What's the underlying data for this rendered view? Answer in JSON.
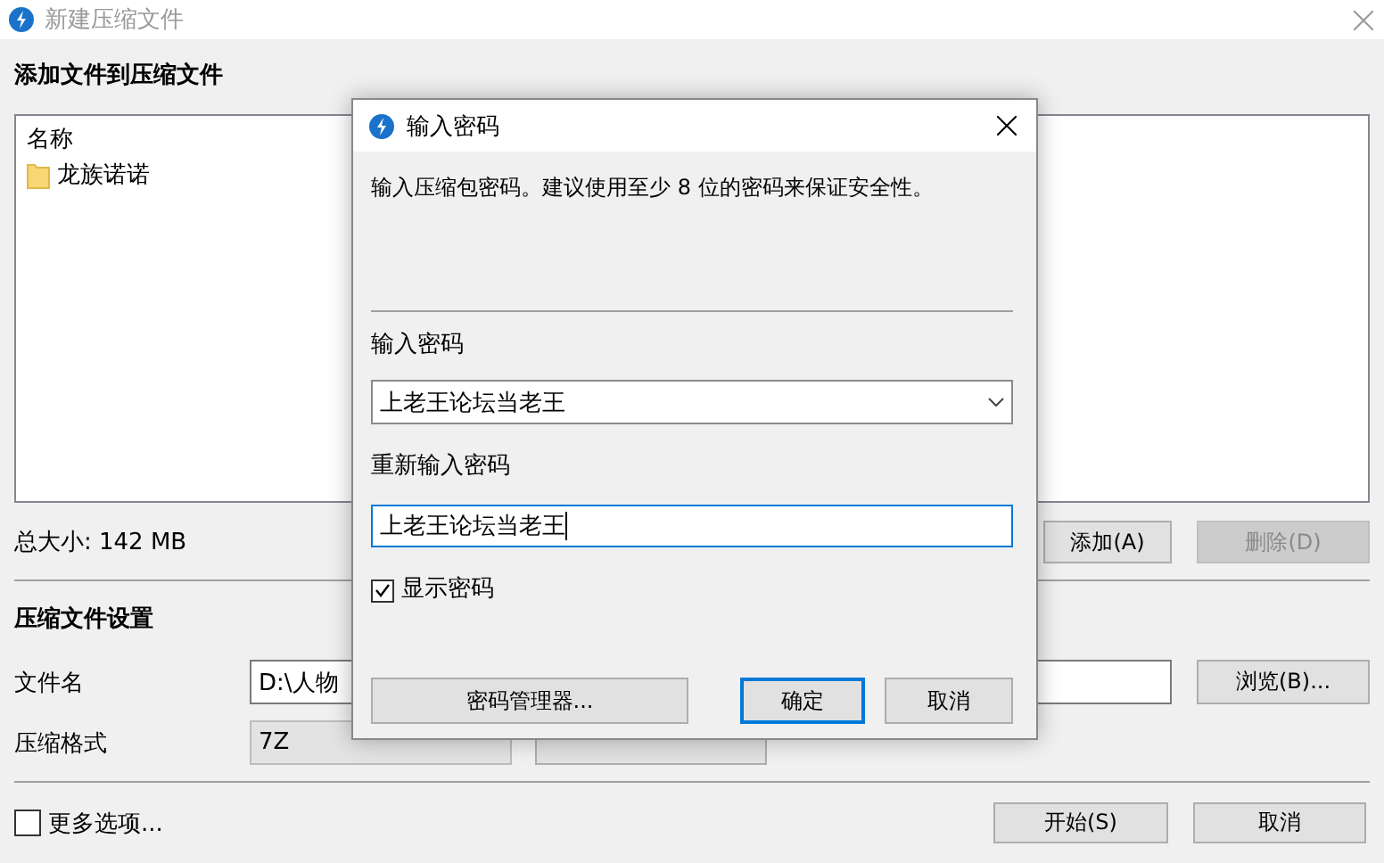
{
  "window": {
    "title": "新建压缩文件",
    "active": false
  },
  "add_section": {
    "heading": "添加文件到压缩文件",
    "list": {
      "columns": [
        "名称"
      ],
      "items": [
        {
          "name": "龙族诺诺",
          "kind": "folder"
        }
      ]
    },
    "total_size": "总大小: 142 MB",
    "buttons": [
      {
        "label": "添加(A)",
        "disabled": false
      },
      {
        "label": "删除(D)",
        "disabled": true
      }
    ]
  },
  "settings": {
    "heading": "压缩文件设置",
    "filename": {
      "label": "文件名",
      "value": "D:\\人物"
    },
    "browse_button": "浏览(B)...",
    "format": {
      "label": "压缩格式",
      "value": "7Z",
      "disabled": true
    }
  },
  "more_options": {
    "label": "更多选项...",
    "checked": false
  },
  "footer_buttons": [
    "开始(S)",
    "取消"
  ],
  "dialog": {
    "title": "输入密码",
    "message": "输入压缩包密码。建议使用至少 8 位的密码来保证安全性。",
    "password": {
      "label": "输入密码",
      "value": "上老王论坛当老王"
    },
    "confirm": {
      "label": "重新输入密码",
      "value": "上老王论坛当老王"
    },
    "show_password": {
      "label": "显示密码",
      "checked": true
    },
    "buttons": [
      {
        "label": "密码管理器...",
        "default": false
      },
      {
        "label": "确定",
        "default": true
      },
      {
        "label": "取消",
        "default": false
      }
    ]
  }
}
